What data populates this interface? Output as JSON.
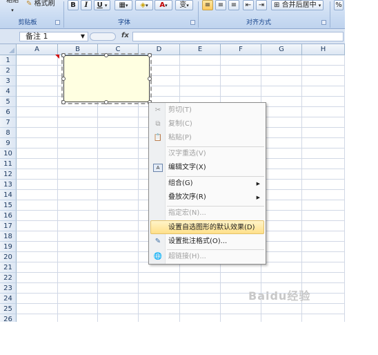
{
  "ribbon": {
    "paste_partial": "粘贴",
    "format_painter": "格式刷",
    "bold": "B",
    "italic": "I",
    "underline": "U",
    "merge_center": "合并后居中",
    "groups": {
      "clipboard": "剪贴板",
      "font": "字体",
      "alignment": "对齐方式"
    }
  },
  "formula_bar": {
    "name_box": "备注 1",
    "fx": "fx"
  },
  "columns": [
    "A",
    "B",
    "C",
    "D",
    "E",
    "F",
    "G",
    "H"
  ],
  "rows": [
    "1",
    "2",
    "3",
    "4",
    "5",
    "6",
    "7",
    "8",
    "9",
    "10",
    "11",
    "12",
    "13",
    "14",
    "15",
    "16",
    "17",
    "18",
    "19",
    "20",
    "21",
    "22",
    "23",
    "24",
    "25",
    "26"
  ],
  "context_menu": {
    "items": [
      {
        "label": "剪切(T)",
        "icon": "scissors-icon",
        "disabled": true
      },
      {
        "label": "复制(C)",
        "icon": "copy-icon",
        "disabled": true
      },
      {
        "label": "粘贴(P)",
        "icon": "paste-icon",
        "disabled": true
      },
      {
        "label": "汉字重选(V)",
        "disabled": true
      },
      {
        "label": "编辑文字(X)",
        "icon": "edit-text-icon",
        "disabled": false
      },
      {
        "label": "组合(G)",
        "submenu": true,
        "disabled": false
      },
      {
        "label": "叠放次序(R)",
        "submenu": true,
        "disabled": false
      },
      {
        "label": "指定宏(N)...",
        "disabled": true
      },
      {
        "label": "设置自选图形的默认效果(D)",
        "disabled": false,
        "highlighted": true
      },
      {
        "label": "设置批注格式(O)...",
        "icon": "format-comment-icon",
        "disabled": false
      },
      {
        "label": "超链接(H)...",
        "icon": "hyperlink-icon",
        "disabled": true
      }
    ]
  },
  "watermark": "Baidu经验",
  "colors": {
    "ribbon_bg": "#c9dbf2",
    "comment_fill": "#ffffe1",
    "menu_highlight": "#ffe08a"
  }
}
